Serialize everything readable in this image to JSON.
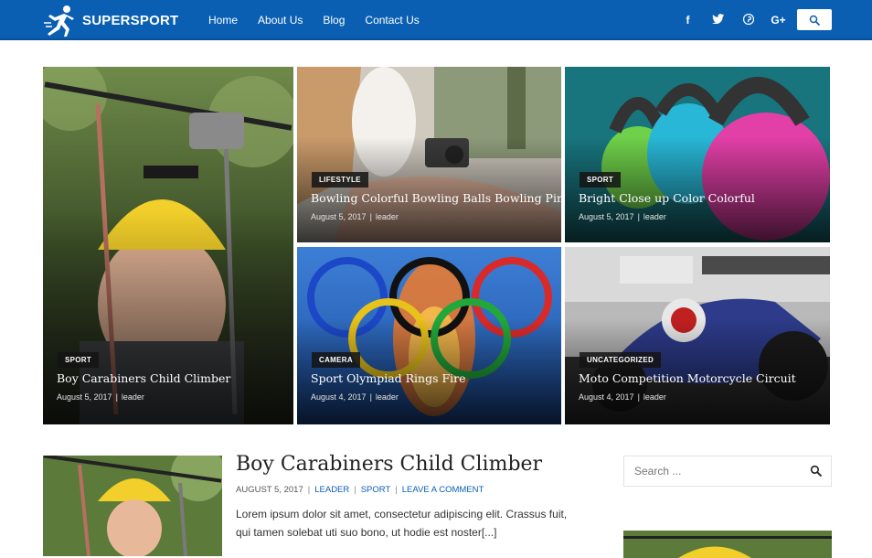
{
  "brand": {
    "name": "SUPERSPORT",
    "color": "#0a5fb3"
  },
  "nav": [
    "Home",
    "About Us",
    "Blog",
    "Contact Us"
  ],
  "social": [
    {
      "icon": "facebook-icon",
      "glyph": "f"
    },
    {
      "icon": "twitter-icon",
      "glyph": "🐦"
    },
    {
      "icon": "pinterest-icon",
      "glyph": "℗"
    },
    {
      "icon": "google-plus-icon",
      "glyph": "G+"
    }
  ],
  "featured": [
    {
      "category": "SPORT",
      "title": "Boy Carabiners Child Climber",
      "date": "August 5, 2017",
      "author": "leader"
    },
    {
      "category": "LIFESTYLE",
      "title": "Bowling Colorful Bowling Balls Bowling Pin",
      "date": "August 5, 2017",
      "author": "leader"
    },
    {
      "category": "SPORT",
      "title": "Bright Close up Color Colorful",
      "date": "August 5, 2017",
      "author": "leader"
    },
    {
      "category": "CAMERA",
      "title": "Sport Olympiad Rings Fire",
      "date": "August 4, 2017",
      "author": "leader"
    },
    {
      "category": "UNCATEGORIZED",
      "title": "Moto Competition Motorcycle Circuit",
      "date": "August 4, 2017",
      "author": "leader"
    }
  ],
  "post": {
    "title": "Boy Carabiners Child Climber",
    "date": "AUGUST 5, 2017",
    "author": "LEADER",
    "category": "SPORT",
    "comments": "LEAVE A COMMENT",
    "excerpt": "Lorem ipsum dolor sit amet, consectetur adipiscing elit. Crassus fuit, qui tamen solebat uti suo bono, ut hodie est noster[...]"
  },
  "sidebar": {
    "search_placeholder": "Search ..."
  }
}
